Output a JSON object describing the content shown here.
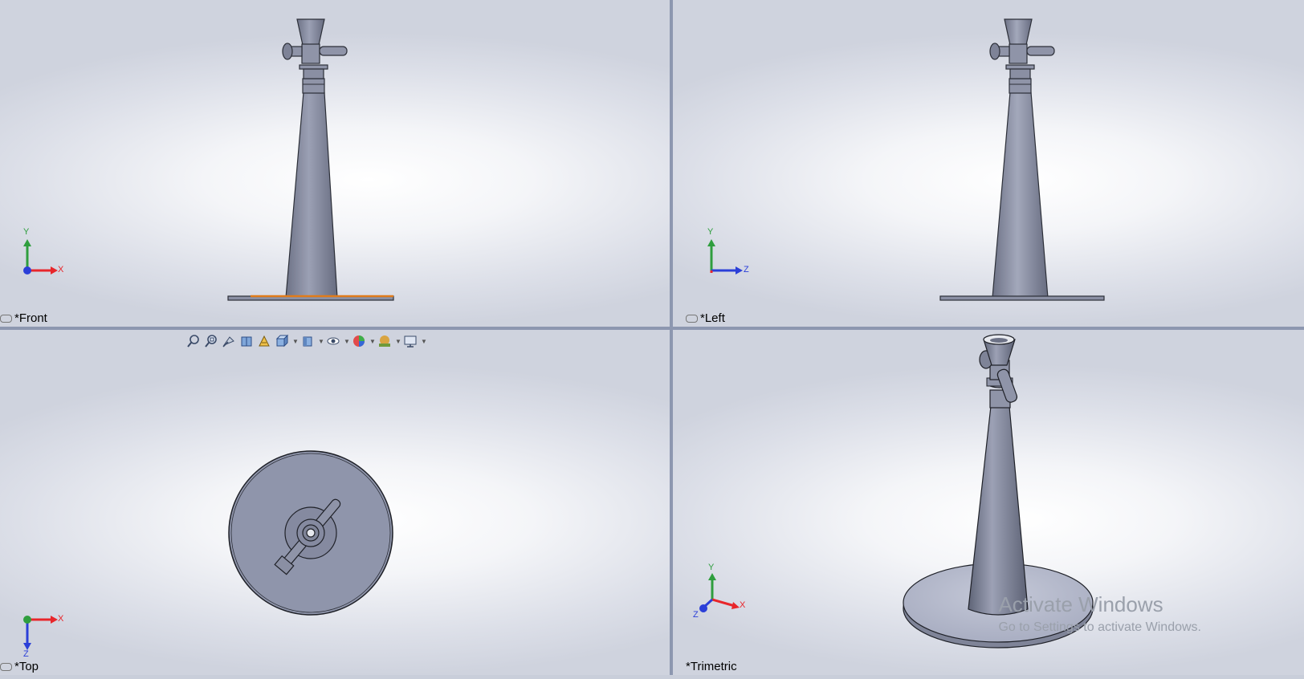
{
  "viewports": {
    "front": {
      "label": "*Front",
      "axes": {
        "vertical": "Y",
        "horizontal": "X"
      }
    },
    "left": {
      "label": "*Left",
      "axes": {
        "vertical": "Y",
        "horizontal": "Z"
      }
    },
    "top": {
      "label": "*Top",
      "axes": {
        "vertical": "Z",
        "horizontal": "X"
      }
    },
    "trimetric": {
      "label": "*Trimetric",
      "axes": {
        "vertical": "Y",
        "horizontal": "X",
        "depth": "Z"
      }
    }
  },
  "heads_up_toolbar": {
    "icons": [
      "zoom-to-fit-icon",
      "zoom-to-area-icon",
      "previous-view-icon",
      "section-view-icon",
      "dynamic-annotation-icon",
      "view-orientation-icon",
      "display-style-icon",
      "hide-show-items-icon",
      "edit-appearance-icon",
      "apply-scene-icon",
      "view-settings-icon"
    ]
  },
  "watermark": {
    "line1": "Activate Windows",
    "line2": "Go to Settings to activate Windows."
  },
  "colors": {
    "model": "#8a8fa3",
    "model_dark": "#5f6476",
    "axis_x": "#e8262b",
    "axis_y": "#2f9e3e",
    "axis_z": "#2b3fd8",
    "selected_edge": "#e07b1a"
  }
}
